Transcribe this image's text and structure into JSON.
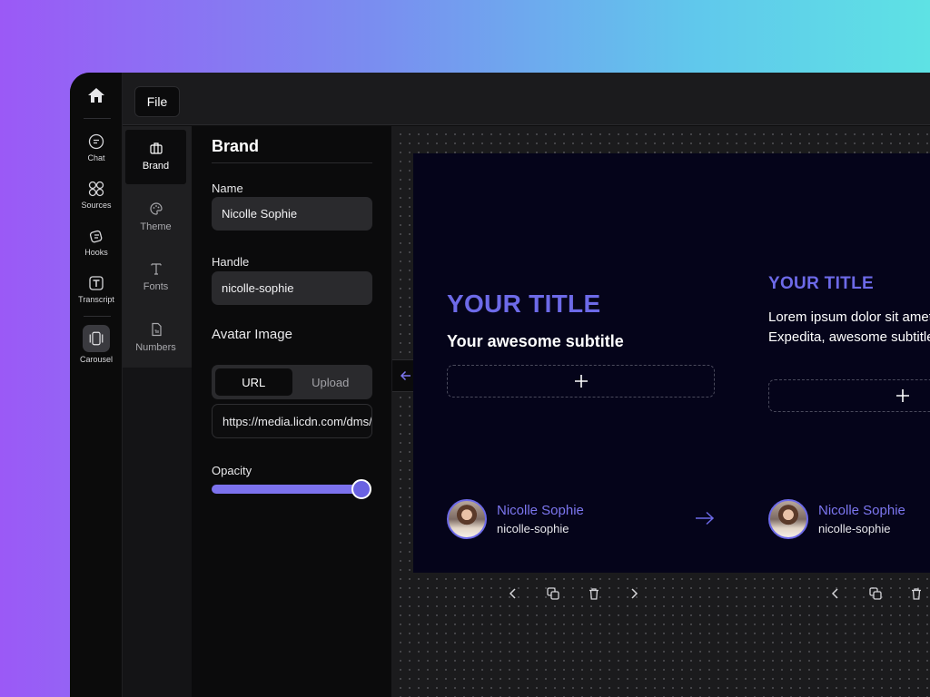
{
  "rail": {
    "items": [
      {
        "label": "Chat",
        "icon": "chat-icon"
      },
      {
        "label": "Sources",
        "icon": "sources-icon"
      },
      {
        "label": "Hooks",
        "icon": "hooks-icon"
      },
      {
        "label": "Transcript",
        "icon": "transcript-icon"
      },
      {
        "label": "Carousel",
        "icon": "carousel-icon"
      }
    ]
  },
  "topbar": {
    "file_label": "File"
  },
  "categories": [
    {
      "label": "Brand",
      "icon": "briefcase-icon"
    },
    {
      "label": "Theme",
      "icon": "palette-icon"
    },
    {
      "label": "Fonts",
      "icon": "type-icon"
    },
    {
      "label": "Numbers",
      "icon": "numbers-icon"
    }
  ],
  "panel": {
    "title": "Brand",
    "name_label": "Name",
    "name_value": "Nicolle Sophie",
    "handle_label": "Handle",
    "handle_value": "nicolle-sophie",
    "avatar_label": "Avatar Image",
    "tab_url": "URL",
    "tab_upload": "Upload",
    "url_value": "https://media.licdn.com/dms/image",
    "opacity_label": "Opacity",
    "opacity_level": 1.0
  },
  "slides": [
    {
      "title": "YOUR TITLE",
      "subtitle": "Your awesome subtitle",
      "author_name": "Nicolle Sophie",
      "author_handle": "nicolle-sophie"
    },
    {
      "title": "YOUR TITLE",
      "body": "Lorem ipsum dolor sit amet adipisicing elit. Expedita, awesome subtitle",
      "author_name": "Nicolle Sophie",
      "author_handle": "nicolle-sophie"
    }
  ],
  "colors": {
    "accent": "#6d6ae8",
    "slide_bg": "#05041a"
  }
}
